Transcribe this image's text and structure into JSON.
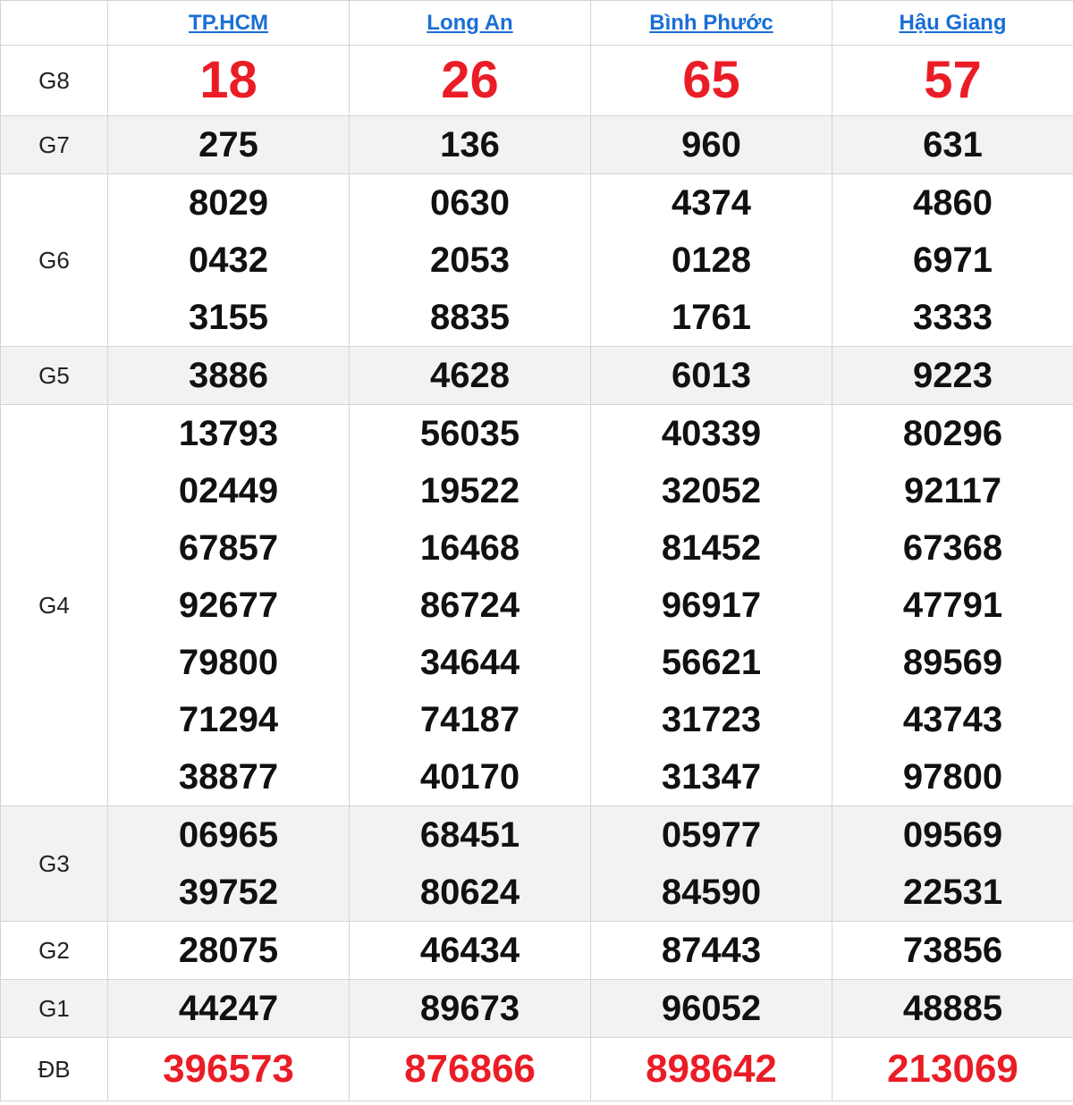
{
  "provinces": [
    "TP.HCM",
    "Long An",
    "Bình Phước",
    "Hậu Giang"
  ],
  "prizes": [
    {
      "label": "G8",
      "values": [
        [
          "18"
        ],
        [
          "26"
        ],
        [
          "65"
        ],
        [
          "57"
        ]
      ]
    },
    {
      "label": "G7",
      "values": [
        [
          "275"
        ],
        [
          "136"
        ],
        [
          "960"
        ],
        [
          "631"
        ]
      ]
    },
    {
      "label": "G6",
      "values": [
        [
          "8029",
          "0432",
          "3155"
        ],
        [
          "0630",
          "2053",
          "8835"
        ],
        [
          "4374",
          "0128",
          "1761"
        ],
        [
          "4860",
          "6971",
          "3333"
        ]
      ]
    },
    {
      "label": "G5",
      "values": [
        [
          "3886"
        ],
        [
          "4628"
        ],
        [
          "6013"
        ],
        [
          "9223"
        ]
      ]
    },
    {
      "label": "G4",
      "values": [
        [
          "13793",
          "02449",
          "67857",
          "92677",
          "79800",
          "71294",
          "38877"
        ],
        [
          "56035",
          "19522",
          "16468",
          "86724",
          "34644",
          "74187",
          "40170"
        ],
        [
          "40339",
          "32052",
          "81452",
          "96917",
          "56621",
          "31723",
          "31347"
        ],
        [
          "80296",
          "92117",
          "67368",
          "47791",
          "89569",
          "43743",
          "97800"
        ]
      ]
    },
    {
      "label": "G3",
      "values": [
        [
          "06965",
          "39752"
        ],
        [
          "68451",
          "80624"
        ],
        [
          "05977",
          "84590"
        ],
        [
          "09569",
          "22531"
        ]
      ]
    },
    {
      "label": "G2",
      "values": [
        [
          "28075"
        ],
        [
          "46434"
        ],
        [
          "87443"
        ],
        [
          "73856"
        ]
      ]
    },
    {
      "label": "G1",
      "values": [
        [
          "44247"
        ],
        [
          "89673"
        ],
        [
          "96052"
        ],
        [
          "48885"
        ]
      ]
    },
    {
      "label": "ĐB",
      "values": [
        [
          "396573"
        ],
        [
          "876866"
        ],
        [
          "898642"
        ],
        [
          "213069"
        ]
      ]
    }
  ],
  "colors": {
    "special": "#ea1d26",
    "link": "#1a6fd6",
    "row_alt": "#f2f2f2"
  }
}
